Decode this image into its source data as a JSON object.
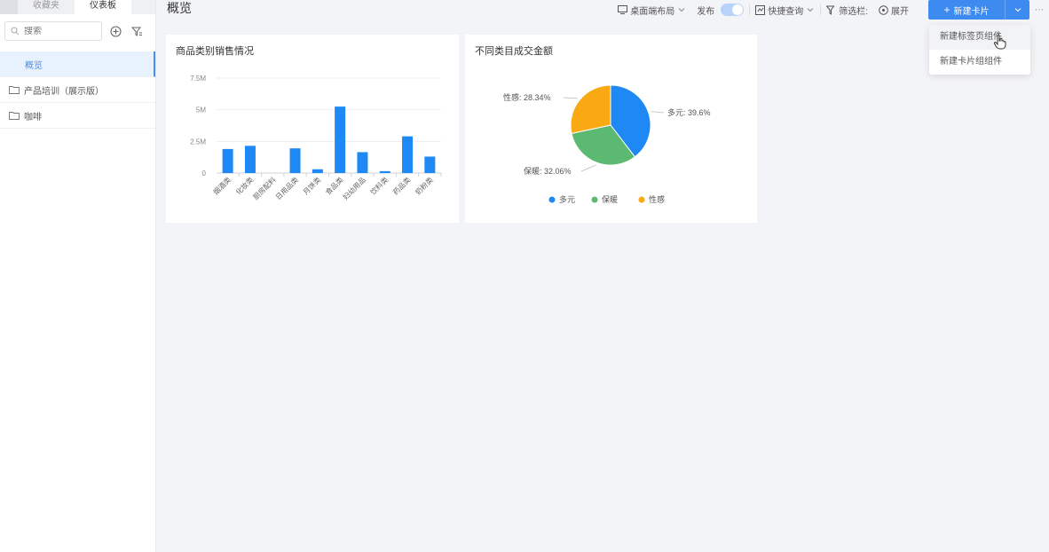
{
  "sidebar": {
    "tabs": [
      {
        "label": "收藏夹",
        "active": false
      },
      {
        "label": "仪表板",
        "active": true
      }
    ],
    "search_placeholder": "搜索",
    "items": [
      {
        "label": "概览",
        "type": "page",
        "active": true
      },
      {
        "label": "产品培训（展示版）",
        "type": "folder",
        "active": false
      },
      {
        "label": "咖啡",
        "type": "folder",
        "active": false
      }
    ]
  },
  "header": {
    "title": "概览",
    "layout_label": "桌面端布局",
    "publish_label": "发布",
    "publish_on": true,
    "quick_query_label": "快捷查询",
    "filter_label": "筛选栏:",
    "expand_label": "展开",
    "new_card_label": "新建卡片"
  },
  "dropdown": {
    "items": [
      {
        "label": "新建标签页组件",
        "hovered": true
      },
      {
        "label": "新建卡片组组件",
        "hovered": false
      }
    ]
  },
  "colors": {
    "accent": "#3d8bf0",
    "bar": "#1e88f5",
    "pie_blue": "#1e88f5",
    "pie_green": "#5bb971",
    "pie_orange": "#f9a912"
  },
  "chart_data": [
    {
      "type": "bar",
      "title": "商品类别销售情况",
      "categories": [
        "烟酒类",
        "化妆类",
        "厨房配料",
        "日用品类",
        "月饼类",
        "食品类",
        "妇幼用品",
        "饮料类",
        "药品类",
        "奶粉类"
      ],
      "values": [
        1900000,
        2150000,
        0,
        1950000,
        300000,
        5250000,
        1650000,
        150000,
        2900000,
        1300000
      ],
      "yticks": [
        "0",
        "2.5M",
        "5M",
        "7.5M"
      ],
      "ylim": [
        0,
        7500000
      ],
      "grid": true,
      "xlabel": "",
      "ylabel": ""
    },
    {
      "type": "pie",
      "title": "不同类目成交金额",
      "slices": [
        {
          "name": "多元",
          "value": 39.6,
          "label": "多元: 39.6%",
          "color": "#1e88f5"
        },
        {
          "name": "保暖",
          "value": 32.06,
          "label": "保暖: 32.06%",
          "color": "#5bb971"
        },
        {
          "name": "性感",
          "value": 28.34,
          "label": "性感: 28.34%",
          "color": "#f9a912"
        }
      ],
      "legend": [
        "多元",
        "保暖",
        "性感"
      ],
      "legend_position": "bottom"
    }
  ]
}
